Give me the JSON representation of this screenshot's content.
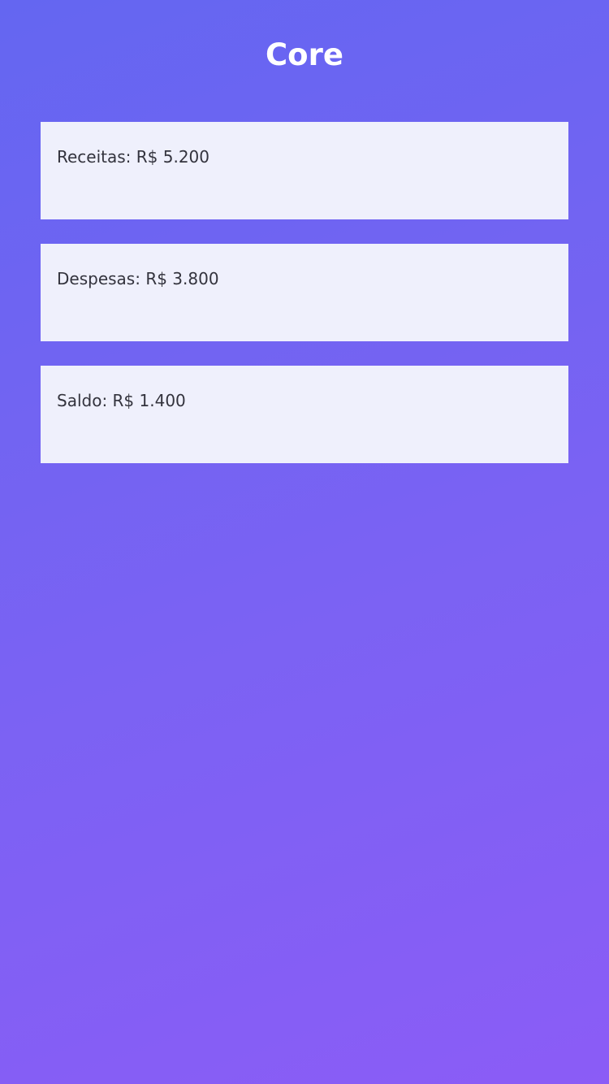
{
  "header": {
    "title": "Core"
  },
  "summary": {
    "cards": [
      {
        "label": "Receitas: R$ 5.200"
      },
      {
        "label": "Despesas: R$ 3.800"
      },
      {
        "label": "Saldo: R$ 1.400"
      }
    ]
  },
  "colors": {
    "background_start": "#6466f1",
    "background_end": "#8b5cf6",
    "card_background": "#eff0fc",
    "card_text": "#33333d",
    "title_text": "#ffffff"
  }
}
